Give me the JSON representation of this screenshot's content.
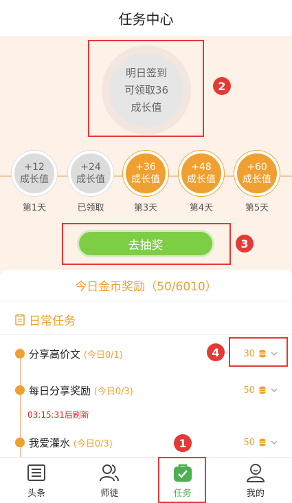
{
  "header": {
    "title": "任务中心"
  },
  "sign": {
    "line1": "明日签到",
    "line2": "可领取36",
    "line3": "成长值"
  },
  "days": [
    {
      "value": "+12",
      "unit": "成长值",
      "label": "第1天",
      "state": "grey"
    },
    {
      "value": "+24",
      "unit": "成长值",
      "label": "已领取",
      "state": "grey"
    },
    {
      "value": "+36",
      "unit": "成长值",
      "label": "第3天",
      "state": "gold"
    },
    {
      "value": "+48",
      "unit": "成长值",
      "label": "第4天",
      "state": "gold"
    },
    {
      "value": "+60",
      "unit": "成长值",
      "label": "第5天",
      "state": "gold"
    }
  ],
  "lottery": {
    "label": "去抽奖"
  },
  "coin_reward": {
    "title": "今日金币奖励（50/6010）"
  },
  "daily": {
    "title": "日常任务",
    "tasks": [
      {
        "name": "分享高价文",
        "progress": "(今日0/1)",
        "reward": "30"
      },
      {
        "name": "每日分享奖励",
        "progress": "(今日0/3)",
        "reward": "50"
      },
      {
        "name": "我爱灌水",
        "progress": "(今日0/3)",
        "reward": "50"
      }
    ],
    "refresh": "03:15:31后刷新"
  },
  "badges": [
    "1",
    "2",
    "3",
    "4"
  ],
  "tabs": [
    {
      "label": "头条",
      "icon": "news-icon"
    },
    {
      "label": "师徒",
      "icon": "users-icon"
    },
    {
      "label": "任务",
      "icon": "task-bag-icon"
    },
    {
      "label": "我的",
      "icon": "profile-icon"
    }
  ],
  "colors": {
    "accent": "#f0a030",
    "green": "#7dcd45",
    "highlight": "#e53935"
  }
}
